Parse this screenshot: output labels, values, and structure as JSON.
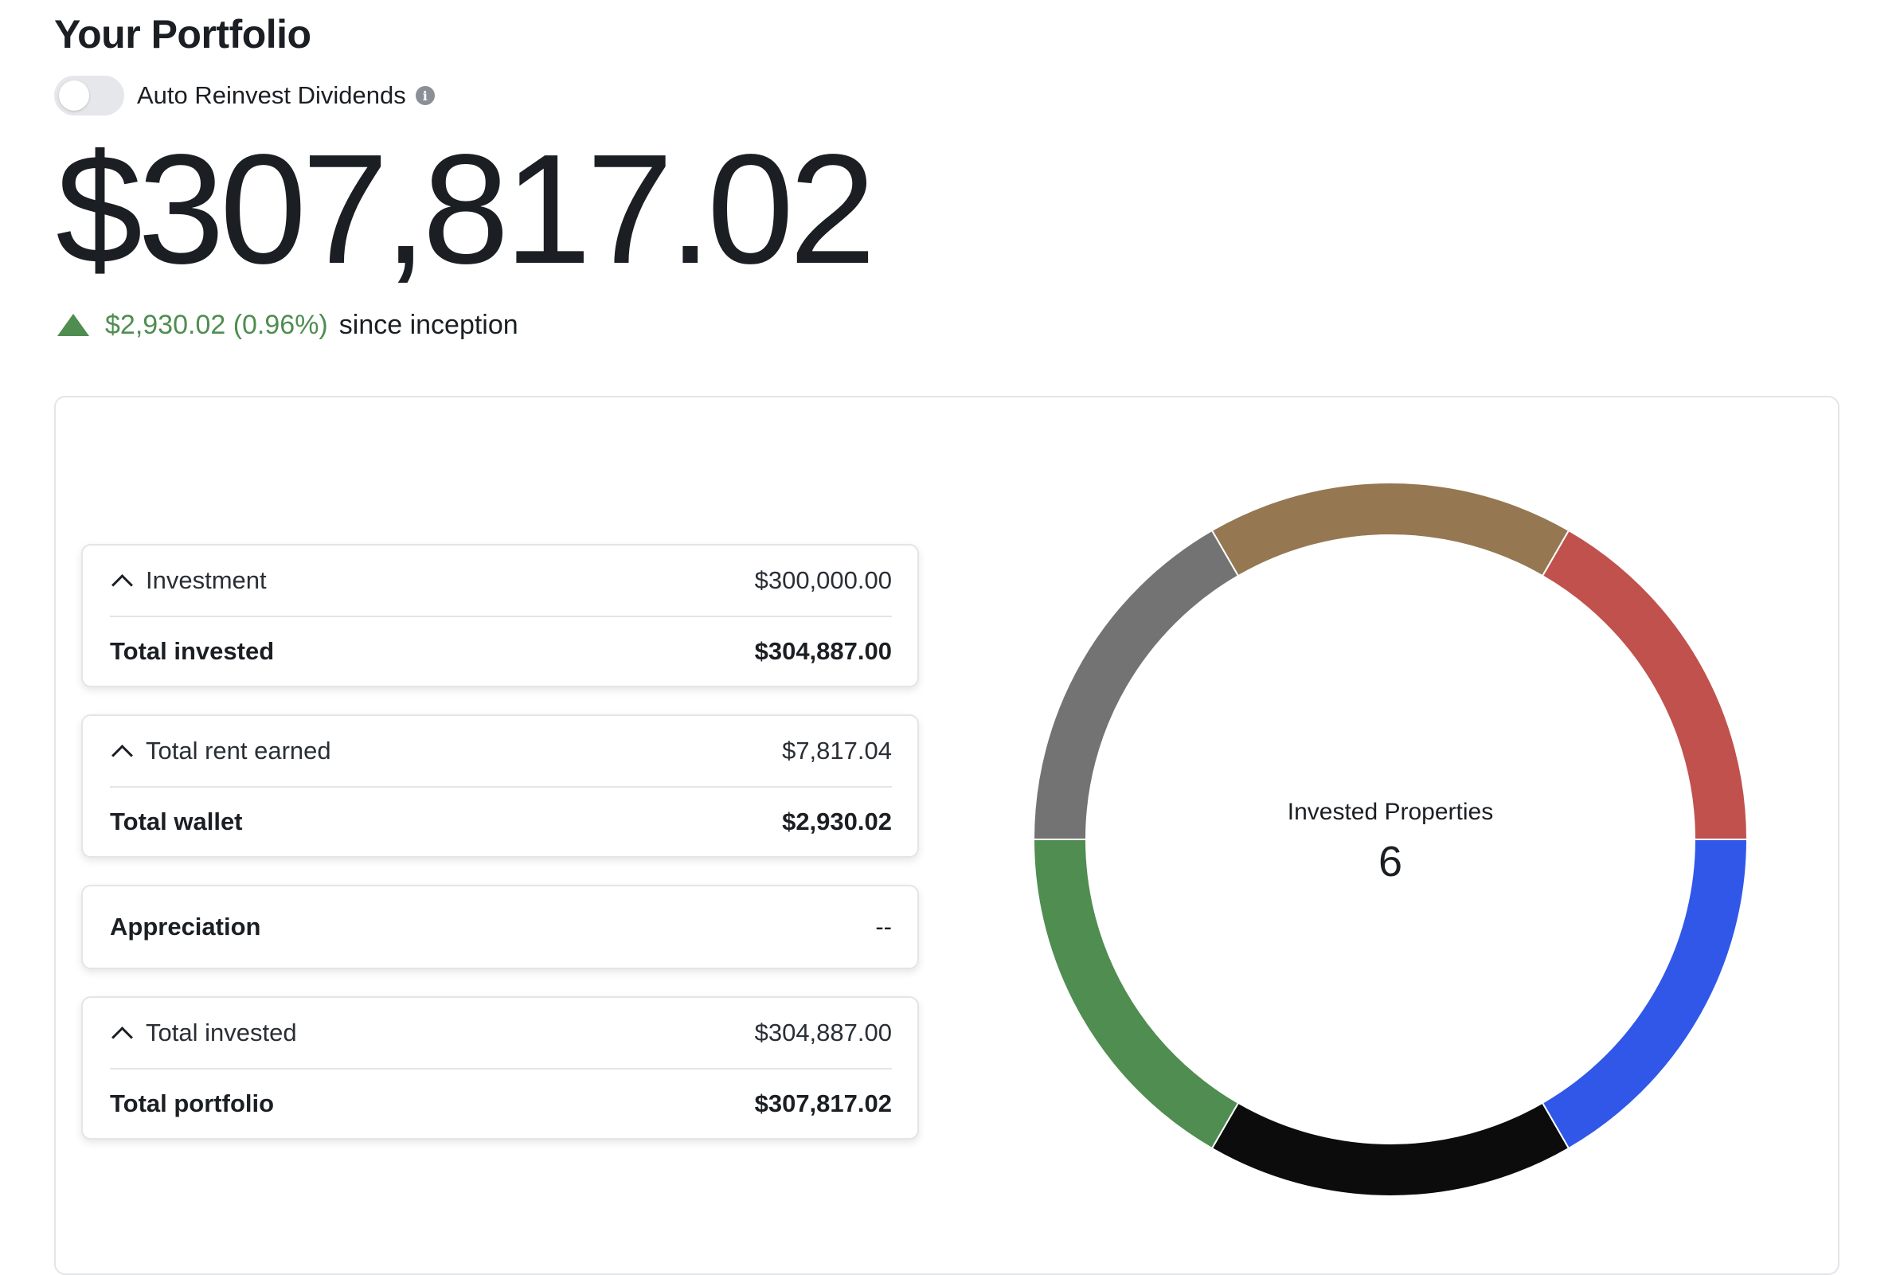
{
  "header": {
    "title": "Your Portfolio"
  },
  "toggle": {
    "label": "Auto Reinvest Dividends",
    "info_icon": "info-icon",
    "on": false
  },
  "balance": {
    "value": "$307,817.02"
  },
  "change": {
    "icon": "triangle-up-icon",
    "value": "$2,930.02 (0.96%)",
    "suffix": "since inception",
    "color": "#4f8d50"
  },
  "cards": [
    {
      "top_label": "Investment",
      "top_value": "$300,000.00",
      "bottom_label": "Total invested",
      "bottom_value": "$304,887.00"
    },
    {
      "top_label": "Total rent earned",
      "top_value": "$7,817.04",
      "bottom_label": "Total wallet",
      "bottom_value": "$2,930.02"
    },
    {
      "label": "Appreciation",
      "value": "--"
    },
    {
      "top_label": "Total invested",
      "top_value": "$304,887.00",
      "bottom_label": "Total portfolio",
      "bottom_value": "$307,817.02"
    }
  ],
  "chart_data": {
    "type": "pie",
    "center_label": "Invested Properties",
    "center_value": "6",
    "series": [
      {
        "values": [
          1,
          1,
          1,
          1,
          1,
          1
        ]
      }
    ],
    "colors": [
      "#c0514d",
      "#3157e9",
      "#0c0c0c",
      "#4f8d50",
      "#737373",
      "#957752"
    ]
  }
}
